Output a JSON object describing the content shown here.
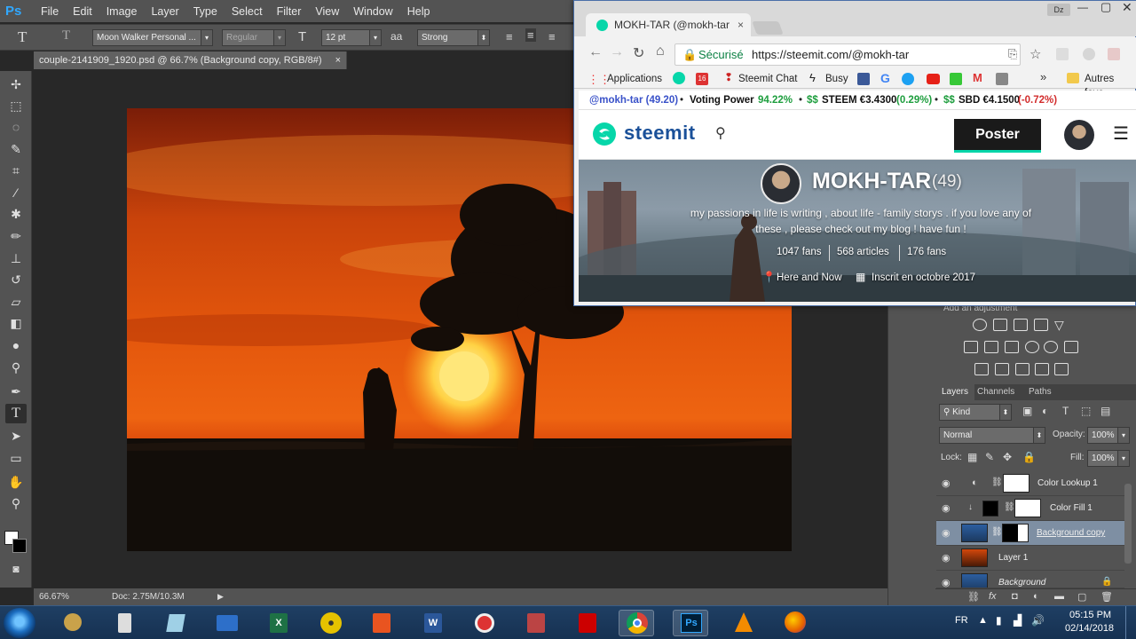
{
  "photoshop": {
    "logo": "Ps",
    "menu": [
      "File",
      "Edit",
      "Image",
      "Layer",
      "Type",
      "Select",
      "Filter",
      "View",
      "Window",
      "Help"
    ],
    "options": {
      "font_family": "Moon Walker Personal ...",
      "font_style": "Regular",
      "font_size": "12 pt",
      "aa_label": "aa",
      "antialias": "Strong"
    },
    "doc_tab": "couple-2141909_1920.psd @ 66.7% (Background copy, RGB/8#)",
    "close_glyph": "×",
    "status": {
      "zoom": "66.67%",
      "doc": "Doc: 2.75M/10.3M"
    },
    "adjustments_title": "Add an adjustment",
    "panel_tabs": [
      "Layers",
      "Channels",
      "Paths"
    ],
    "kind": "Kind",
    "blend_mode": "Normal",
    "opacity_label": "Opacity:",
    "opacity": "100%",
    "lock_label": "Lock:",
    "fill_label": "Fill:",
    "fill": "100%",
    "layers": [
      {
        "name": "Color Lookup 1"
      },
      {
        "name": "Color Fill 1"
      },
      {
        "name": "Background copy"
      },
      {
        "name": "Layer 1"
      },
      {
        "name": "Background"
      }
    ]
  },
  "chrome": {
    "tab_title": "MOKH-TAR (@mokh-tar",
    "user_badge": "Dz",
    "secure_label": "Sécurisé",
    "url": "https://steemit.com/@mokh-tar",
    "bookmarks": [
      "Applications",
      "Steemit Chat",
      "Busy",
      "Autres favo"
    ],
    "bookmark_badge": "16",
    "more_glyph": "»"
  },
  "steem_status": {
    "user": "@mokh-tar (49.20)",
    "voting_label": "Voting Power",
    "voting_value": "94.22%",
    "steem_label": "STEEM €3.4300",
    "steem_change": "(0.29%)",
    "sbd_label": "SBD €4.1500",
    "sbd_change": "(-0.72%)",
    "bullet": "•"
  },
  "steemit": {
    "brand": "steemit",
    "post_button": "Poster",
    "profile_name": "MOKH-TAR",
    "reputation": "(49)",
    "bio": "my passions in life is writing , about life - family storys . if you love any of these , please check out my blog ! have fun !",
    "fans": "1047 fans",
    "articles": "568 articles",
    "following": "176 fans",
    "location": "Here and Now",
    "joined": "Inscrit en octobre 2017"
  },
  "taskbar": {
    "lang": "FR",
    "time": "05:15 PM",
    "date": "02/14/2018"
  },
  "colors": {
    "ps_panel": "#535353",
    "ps_dark": "#282828",
    "steemit_green": "#06d6a9",
    "positive": "#1e9e3e",
    "negative": "#d22d2d"
  }
}
